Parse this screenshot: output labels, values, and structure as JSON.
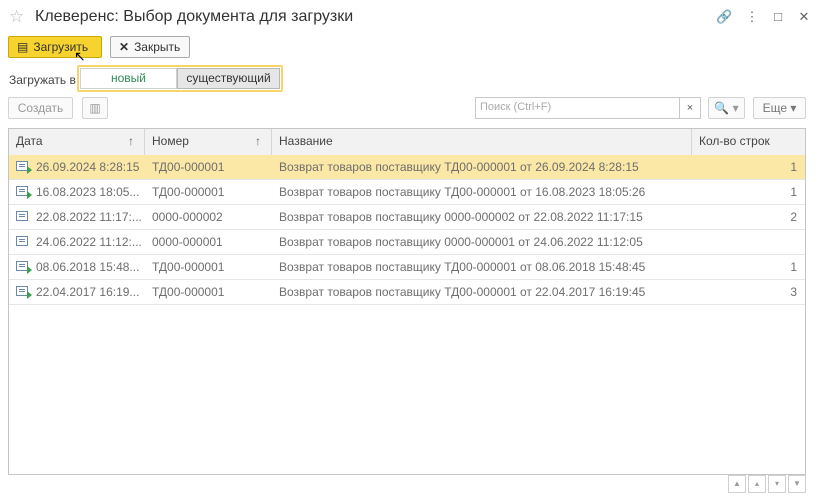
{
  "window": {
    "title": "Клеверенс: Выбор документа для загрузки"
  },
  "toolbar": {
    "load_label": "Загрузить",
    "close_label": "Закрыть"
  },
  "load_into": {
    "label": "Загружать в:",
    "options": [
      "новый",
      "существующий"
    ],
    "selected": "новый"
  },
  "list_toolbar": {
    "create_label": "Создать",
    "search_placeholder": "Поиск (Ctrl+F)",
    "clear_label": "×",
    "search_btn": "🔍 ▾",
    "more_label": "Еще ▾"
  },
  "table": {
    "columns": [
      "Дата",
      "Номер",
      "Название",
      "Кол-во строк"
    ],
    "sort_indicator": "↑",
    "rows": [
      {
        "date": "26.09.2024 8:28:15",
        "number": "ТД00-000001",
        "name": "Возврат товаров поставщику ТД00-000001 от 26.09.2024 8:28:15",
        "count": "1",
        "icon": "doc-green"
      },
      {
        "date": "16.08.2023 18:05...",
        "number": "ТД00-000001",
        "name": "Возврат товаров поставщику ТД00-000001 от 16.08.2023 18:05:26",
        "count": "1",
        "icon": "doc-green"
      },
      {
        "date": "22.08.2022 11:17:...",
        "number": "0000-000002",
        "name": "Возврат товаров поставщику 0000-000002 от 22.08.2022 11:17:15",
        "count": "2",
        "icon": "doc"
      },
      {
        "date": "24.06.2022 11:12:...",
        "number": "0000-000001",
        "name": "Возврат товаров поставщику 0000-000001 от 24.06.2022 11:12:05",
        "count": "",
        "icon": "doc"
      },
      {
        "date": "08.06.2018 15:48...",
        "number": "ТД00-000001",
        "name": "Возврат товаров поставщику ТД00-000001 от 08.06.2018 15:48:45",
        "count": "1",
        "icon": "doc-green"
      },
      {
        "date": "22.04.2017 16:19...",
        "number": "ТД00-000001",
        "name": "Возврат товаров поставщику ТД00-000001 от 22.04.2017 16:19:45",
        "count": "3",
        "icon": "doc-green"
      }
    ]
  }
}
